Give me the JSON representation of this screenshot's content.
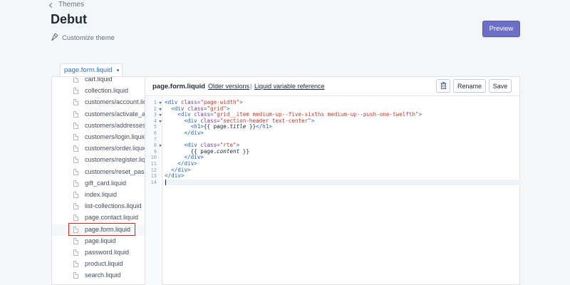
{
  "breadcrumb": {
    "label": "Themes"
  },
  "page": {
    "title": "Debut",
    "customize_label": "Customize theme"
  },
  "header": {
    "preview_label": "Preview"
  },
  "open_tab": {
    "label": "page.form.liquid"
  },
  "sidebar": {
    "files": [
      "cart.liquid",
      "collection.liquid",
      "customers/account.liquid",
      "customers/activate_account.liquid",
      "customers/addresses.liquid",
      "customers/login.liquid",
      "customers/order.liquid",
      "customers/register.liquid",
      "customers/reset_password.liquid",
      "gift_card.liquid",
      "index.liquid",
      "list-collections.liquid",
      "page.contact.liquid",
      "page.form.liquid",
      "page.liquid",
      "password.liquid",
      "product.liquid",
      "search.liquid"
    ],
    "active_index": 13
  },
  "editor": {
    "filename": "page.form.liquid",
    "older_versions_label": "Older versions",
    "separator": "|",
    "liquid_ref_label": "Liquid variable reference",
    "rename_label": "Rename",
    "save_label": "Save",
    "delete_icon": "trash-icon",
    "line_numbers": [
      "1",
      "2",
      "3",
      "4",
      "5",
      "6",
      "7",
      "8",
      "9",
      "10",
      "11",
      "12",
      "13",
      "14"
    ],
    "foldable_lines": [
      1,
      2,
      3,
      4,
      8
    ],
    "active_line": 14,
    "code_lines": [
      [
        [
          "t-tag",
          "<div "
        ],
        [
          "t-attr",
          "class="
        ],
        [
          "t-str",
          "\"page-width\""
        ],
        [
          "t-tag",
          ">"
        ]
      ],
      [
        [
          "t-txt",
          "  "
        ],
        [
          "t-tag",
          "<div "
        ],
        [
          "t-attr",
          "class="
        ],
        [
          "t-str",
          "\"grid\""
        ],
        [
          "t-tag",
          ">"
        ]
      ],
      [
        [
          "t-txt",
          "    "
        ],
        [
          "t-tag",
          "<div "
        ],
        [
          "t-attr",
          "class="
        ],
        [
          "t-str",
          "\"grid__item medium-up--five-sixths medium-up--push-one-twelfth\""
        ],
        [
          "t-tag",
          ">"
        ]
      ],
      [
        [
          "t-txt",
          "      "
        ],
        [
          "t-tag",
          "<div "
        ],
        [
          "t-attr",
          "class="
        ],
        [
          "t-str",
          "\"section-header text-center\""
        ],
        [
          "t-tag",
          ">"
        ]
      ],
      [
        [
          "t-txt",
          "        "
        ],
        [
          "t-tag",
          "<h1>"
        ],
        [
          "t-txt",
          "{{ page."
        ],
        [
          "t-var",
          "title"
        ],
        [
          "t-txt",
          " }}"
        ],
        [
          "t-tag",
          "</h1>"
        ]
      ],
      [
        [
          "t-txt",
          "      "
        ],
        [
          "t-tag",
          "</div>"
        ]
      ],
      [],
      [
        [
          "t-txt",
          "      "
        ],
        [
          "t-tag",
          "<div "
        ],
        [
          "t-attr",
          "class="
        ],
        [
          "t-str",
          "\"rte\""
        ],
        [
          "t-tag",
          ">"
        ]
      ],
      [
        [
          "t-txt",
          "        {{ page."
        ],
        [
          "t-var",
          "content"
        ],
        [
          "t-txt",
          " }}"
        ]
      ],
      [
        [
          "t-txt",
          "      "
        ],
        [
          "t-tag",
          "</div>"
        ]
      ],
      [
        [
          "t-txt",
          "    "
        ],
        [
          "t-tag",
          "</div>"
        ]
      ],
      [
        [
          "t-txt",
          "  "
        ],
        [
          "t-tag",
          "</div>"
        ]
      ],
      [
        [
          "t-tag",
          "</div>"
        ]
      ],
      []
    ]
  }
}
